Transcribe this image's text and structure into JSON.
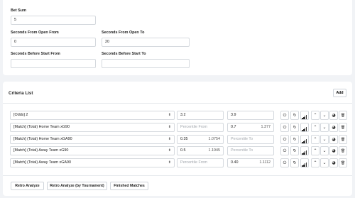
{
  "filters": {
    "bet_sum": {
      "label": "Bet Sum",
      "value": "5"
    },
    "seconds_from_open_from": {
      "label": "Seconds From Open From",
      "value": "0"
    },
    "seconds_from_open_to": {
      "label": "Seconds From Open To",
      "value": "20"
    },
    "seconds_before_start_from": {
      "label": "Seconds Before Start From",
      "value": ""
    },
    "seconds_before_start_to": {
      "label": "Seconds Before Start To",
      "value": ""
    }
  },
  "criteria": {
    "title": "Criteria List",
    "add_label": "Add",
    "percentile_from_placeholder": "Percentile From",
    "percentile_to_placeholder": "Percentile To",
    "rows": [
      {
        "name": "[Odds] 2",
        "from": "3.2",
        "from_sub": "",
        "to": "3.9",
        "to_sub": ""
      },
      {
        "name": "[Match] (Total) Home Team xG90",
        "from": "",
        "from_sub": "",
        "to": "0.7",
        "to_sub": "1.377"
      },
      {
        "name": "[Match] (Total) Home Team xGA90",
        "from": "0.35",
        "from_sub": "1.0754",
        "to": "",
        "to_sub": ""
      },
      {
        "name": "[Match] (Total) Away Team xG90",
        "from": "0.5",
        "from_sub": "1.1945",
        "to": "",
        "to_sub": ""
      },
      {
        "name": "[Match] (Total) Away Team xGA90",
        "from": "",
        "from_sub": "",
        "to": "0.40",
        "to_sub": "1.1112"
      }
    ],
    "row_icons": [
      "power-icon",
      "refresh-icon",
      "bar-chart-icon",
      "chevron-up-icon",
      "chevron-down-icon",
      "palette-icon",
      "trash-icon"
    ]
  },
  "actions": {
    "retro_analyze": "Retro Analyze",
    "retro_analyze_tournament": "Retro Analyze (by Tournament)",
    "finished_matches": "Finished Matches"
  }
}
